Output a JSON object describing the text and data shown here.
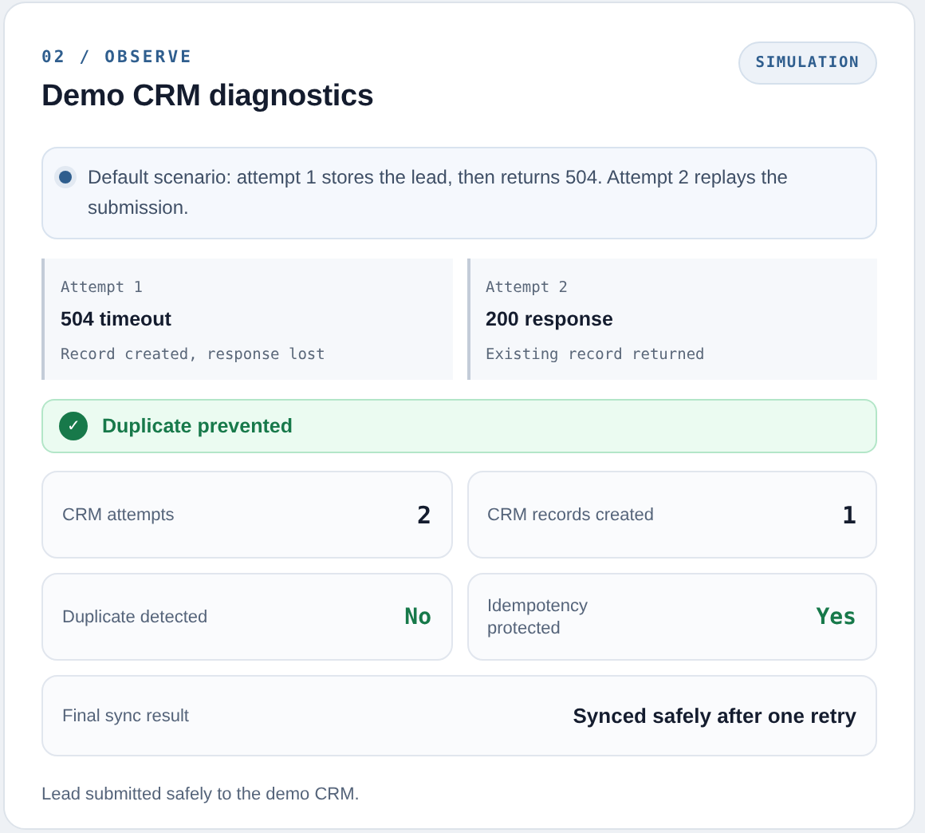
{
  "eyebrow": "02 / OBSERVE",
  "title": "Demo CRM diagnostics",
  "badge": "SIMULATION",
  "scenario": {
    "text": "Default scenario: attempt 1 stores the lead, then returns 504. Attempt 2 replays the submission."
  },
  "attempts": [
    {
      "label": "Attempt 1",
      "status": "504 timeout",
      "detail": "Record created, response lost"
    },
    {
      "label": "Attempt 2",
      "status": "200 response",
      "detail": "Existing record returned"
    }
  ],
  "result_banner": {
    "icon": "✓",
    "text": "Duplicate prevented"
  },
  "stats": [
    {
      "label": "CRM attempts",
      "value": "2",
      "kind": "number"
    },
    {
      "label": "CRM records created",
      "value": "1",
      "kind": "number"
    },
    {
      "label": "Duplicate detected",
      "value": "No",
      "kind": "flag"
    },
    {
      "label": "Idempotency protected",
      "value": "Yes",
      "kind": "flag"
    },
    {
      "label": "Final sync result",
      "value": "Synced safely after one retry",
      "kind": "summary"
    }
  ],
  "footer": "Lead submitted safely to the demo CRM."
}
